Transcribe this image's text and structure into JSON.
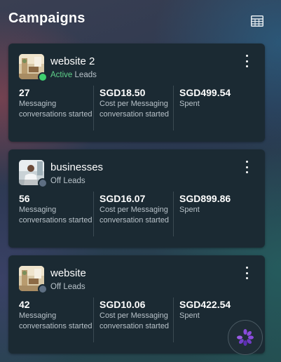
{
  "header": {
    "title": "Campaigns",
    "table_icon": "table-grid-icon"
  },
  "campaigns": [
    {
      "name": "website 2",
      "status": "Active",
      "status_color": "#3ecf6f",
      "objective": "Leads",
      "metrics": [
        {
          "value": "27",
          "label": "Messaging conversations started"
        },
        {
          "value": "SGD18.50",
          "label": "Cost per Messaging conversation started"
        },
        {
          "value": "SGD499.54",
          "label": "Spent"
        }
      ]
    },
    {
      "name": "businesses",
      "status": "Off",
      "status_color": "#5d6e82",
      "objective": "Leads",
      "metrics": [
        {
          "value": "56",
          "label": "Messaging conversations started"
        },
        {
          "value": "SGD16.07",
          "label": "Cost per Messaging conversation started"
        },
        {
          "value": "SGD899.86",
          "label": "Spent"
        }
      ]
    },
    {
      "name": "website",
      "status": "Off",
      "status_color": "#5d6e82",
      "objective": "Leads",
      "metrics": [
        {
          "value": "42",
          "label": "Messaging conversations started"
        },
        {
          "value": "SGD10.06",
          "label": "Cost per Messaging conversation started"
        },
        {
          "value": "SGD422.54",
          "label": "Spent"
        }
      ]
    }
  ],
  "assistant_button": {
    "icon": "ai-assistant-icon",
    "accent": "#8a4bdc"
  }
}
